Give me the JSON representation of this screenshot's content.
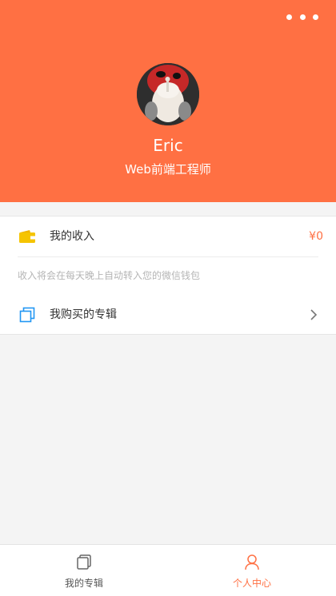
{
  "header": {
    "more_icon": "more-horizontal-icon",
    "user_name": "Eric",
    "user_title": "Web前端工程师",
    "background_color": "#ff7043"
  },
  "income": {
    "icon": "wallet-icon",
    "icon_color": "#f5c400",
    "label": "我的收入",
    "amount": "¥0",
    "note": "收入将会在每天晚上自动转入您的微信钱包"
  },
  "albums": {
    "icon": "album-stack-icon",
    "icon_color": "#2196f3",
    "label": "我购买的专辑",
    "chevron_icon": "chevron-right-icon"
  },
  "tabbar": {
    "tabs": [
      {
        "label": "我的专辑",
        "icon": "album-stack-icon",
        "active": false
      },
      {
        "label": "个人中心",
        "icon": "user-icon",
        "active": true
      }
    ],
    "active_color": "#ff7043"
  }
}
